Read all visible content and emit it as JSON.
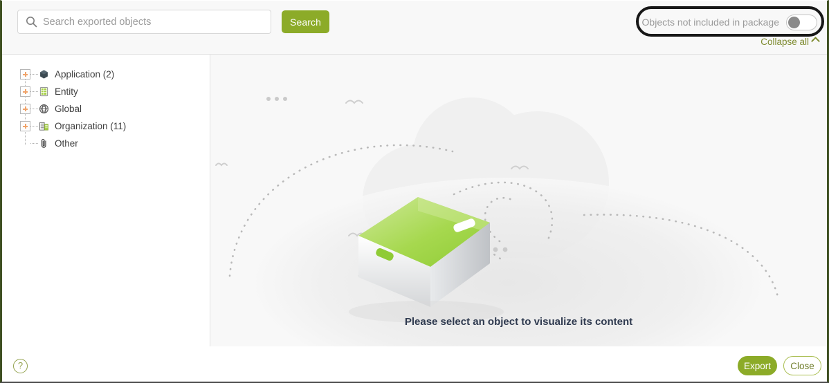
{
  "header": {
    "search": {
      "placeholder": "Search exported objects",
      "value": "",
      "icon": "search-icon",
      "button_label": "Search"
    },
    "filter_toggle": {
      "label": "Objects not included in package",
      "state": "off",
      "highlighted": true,
      "highlight_color": "#171717"
    },
    "collapse_all": {
      "label": "Collapse all",
      "icon": "chevron-up-icon",
      "color": "#7d8a2e"
    }
  },
  "tree": {
    "items": [
      {
        "label": "Application (2)",
        "icon": "application-icon",
        "expandable": true,
        "expanded": false
      },
      {
        "label": "Entity",
        "icon": "entity-icon",
        "expandable": true,
        "expanded": false
      },
      {
        "label": "Global",
        "icon": "global-icon",
        "expandable": true,
        "expanded": false
      },
      {
        "label": "Organization (11)",
        "icon": "organization-icon",
        "expandable": true,
        "expanded": false
      },
      {
        "label": "Other",
        "icon": "other-icon",
        "expandable": false,
        "expanded": false
      }
    ]
  },
  "content": {
    "empty_message": "Please select an object to visualize its content",
    "illustration": "empty-box-cloud-illustration"
  },
  "footer": {
    "help_label": "?",
    "export_label": "Export",
    "close_label": "Close"
  },
  "colors": {
    "accent_green": "#8cab28",
    "link_green": "#7d8a2e",
    "border_green": "#3f5022",
    "content_bg": "#f8f8f8",
    "text_dark": "#2f3a4f"
  }
}
